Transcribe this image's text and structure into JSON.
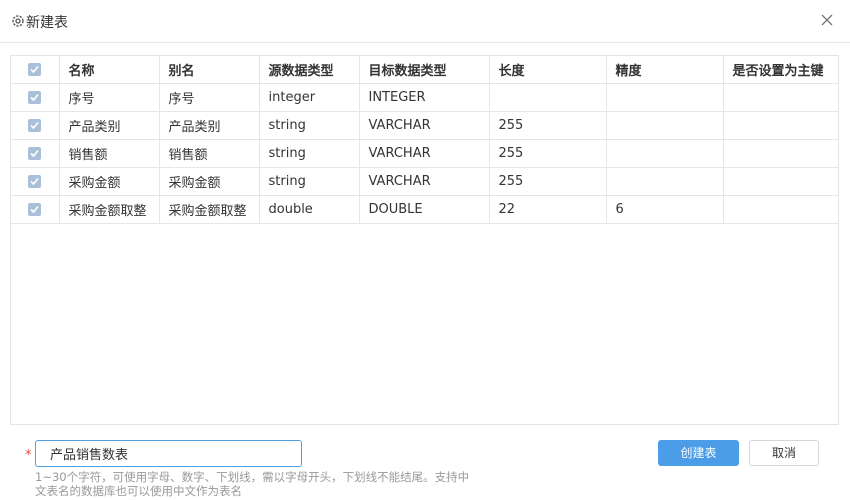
{
  "dialog": {
    "title": "新建表",
    "icons": {
      "title": "gear-icon",
      "close": "close-icon"
    }
  },
  "table": {
    "columns": [
      "名称",
      "别名",
      "源数据类型",
      "目标数据类型",
      "长度",
      "精度",
      "是否设置为主键"
    ],
    "rows": [
      {
        "checked": true,
        "name": "序号",
        "alias": "序号",
        "src_type": "integer",
        "dst_type": "INTEGER",
        "length": "",
        "precision": "",
        "primary_key": ""
      },
      {
        "checked": true,
        "name": "产品类别",
        "alias": "产品类别",
        "src_type": "string",
        "dst_type": "VARCHAR",
        "length": "255",
        "precision": "",
        "primary_key": ""
      },
      {
        "checked": true,
        "name": "销售额",
        "alias": "销售额",
        "src_type": "string",
        "dst_type": "VARCHAR",
        "length": "255",
        "precision": "",
        "primary_key": ""
      },
      {
        "checked": true,
        "name": "采购金额",
        "alias": "采购金额",
        "src_type": "string",
        "dst_type": "VARCHAR",
        "length": "255",
        "precision": "",
        "primary_key": ""
      },
      {
        "checked": true,
        "name": "采购金额取整",
        "alias": "采购金额取整",
        "src_type": "double",
        "dst_type": "DOUBLE",
        "length": "22",
        "precision": "6",
        "primary_key": ""
      }
    ],
    "header_checked": true
  },
  "footer": {
    "required_mark": "*",
    "table_name_value": "产品销售数表",
    "hint_line1": "1~30个字符，可使用字母、数字、下划线，需以字母开头，下划线不能结尾。支持中",
    "hint_line2": "文表名的数据库也可以使用中文作为表名",
    "create_label": "创建表",
    "cancel_label": "取消"
  },
  "colors": {
    "primary": "#4a9de6",
    "input_border": "#4f9fe3",
    "checkbox": "#a9c0d8",
    "required": "#e04848"
  }
}
